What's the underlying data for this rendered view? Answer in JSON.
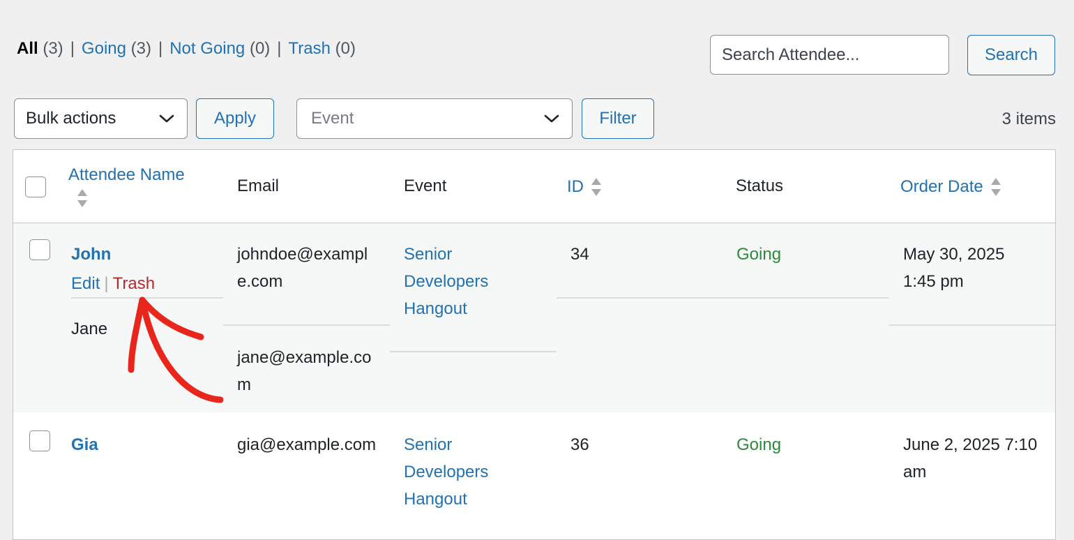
{
  "status_links": {
    "all": {
      "label": "All",
      "count": "(3)"
    },
    "going": {
      "label": "Going",
      "count": "(3)"
    },
    "not_going": {
      "label": "Not Going",
      "count": "(0)"
    },
    "trash": {
      "label": "Trash",
      "count": "(0)"
    },
    "separator": "|"
  },
  "search": {
    "placeholder": "Search Attendee...",
    "button": "Search"
  },
  "toolbar": {
    "bulk_actions": "Bulk actions",
    "apply": "Apply",
    "event_select": "Event",
    "filter": "Filter",
    "items_count": "3 items"
  },
  "table": {
    "headers": {
      "attendee_name": "Attendee Name",
      "email": "Email",
      "event": "Event",
      "id": "ID",
      "status": "Status",
      "order_date": "Order Date"
    },
    "rows": [
      {
        "name": "John",
        "actions": {
          "edit": "Edit",
          "separator": "|",
          "trash": "Trash"
        },
        "email_line1": "johndoe@exampl",
        "email_line2": "e.com",
        "event_line1": "Senior",
        "event_line2": "Developers",
        "event_line3": "Hangout",
        "id": "34",
        "status": "Going",
        "date_line1": "May 30, 2025",
        "date_line2": "1:45 pm",
        "sub_attendee": {
          "name": "Jane",
          "email_line1": "jane@example.co",
          "email_line2": "m"
        }
      },
      {
        "name": "Gia",
        "email": "gia@example.com",
        "event_line1": "Senior",
        "event_line2": "Developers",
        "event_line3": "Hangout",
        "id": "36",
        "status": "Going",
        "date_line1": "June 2, 2025 7:10",
        "date_line2": "am"
      }
    ]
  },
  "colors": {
    "link": "#2271b1",
    "trash": "#b32d2e",
    "going": "#2d8a3a",
    "annotation_arrow": "#e8261c"
  }
}
